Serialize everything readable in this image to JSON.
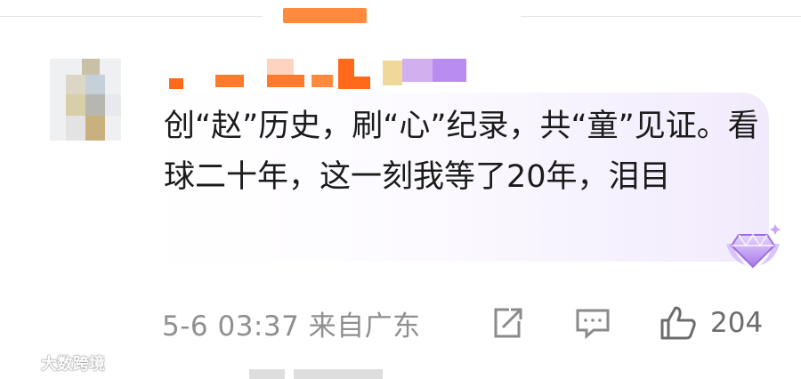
{
  "comment": {
    "text": "创“赵”历史，刷“心”纪录，共“童”见证。看球二十年，这一刻我等了20年，泪目",
    "timestamp": "5-6 03:37 来自广东",
    "like_count": "204"
  },
  "watermark": {
    "text": "大数跨境"
  },
  "colors": {
    "username_orange": "#ff6a1a",
    "badge_purple": "#b48cf0",
    "meta_gray": "#8f8f8f"
  },
  "icons": [
    "share-icon",
    "comment-icon",
    "like-icon",
    "diamond-badge-icon",
    "watermark-logo-icon"
  ]
}
